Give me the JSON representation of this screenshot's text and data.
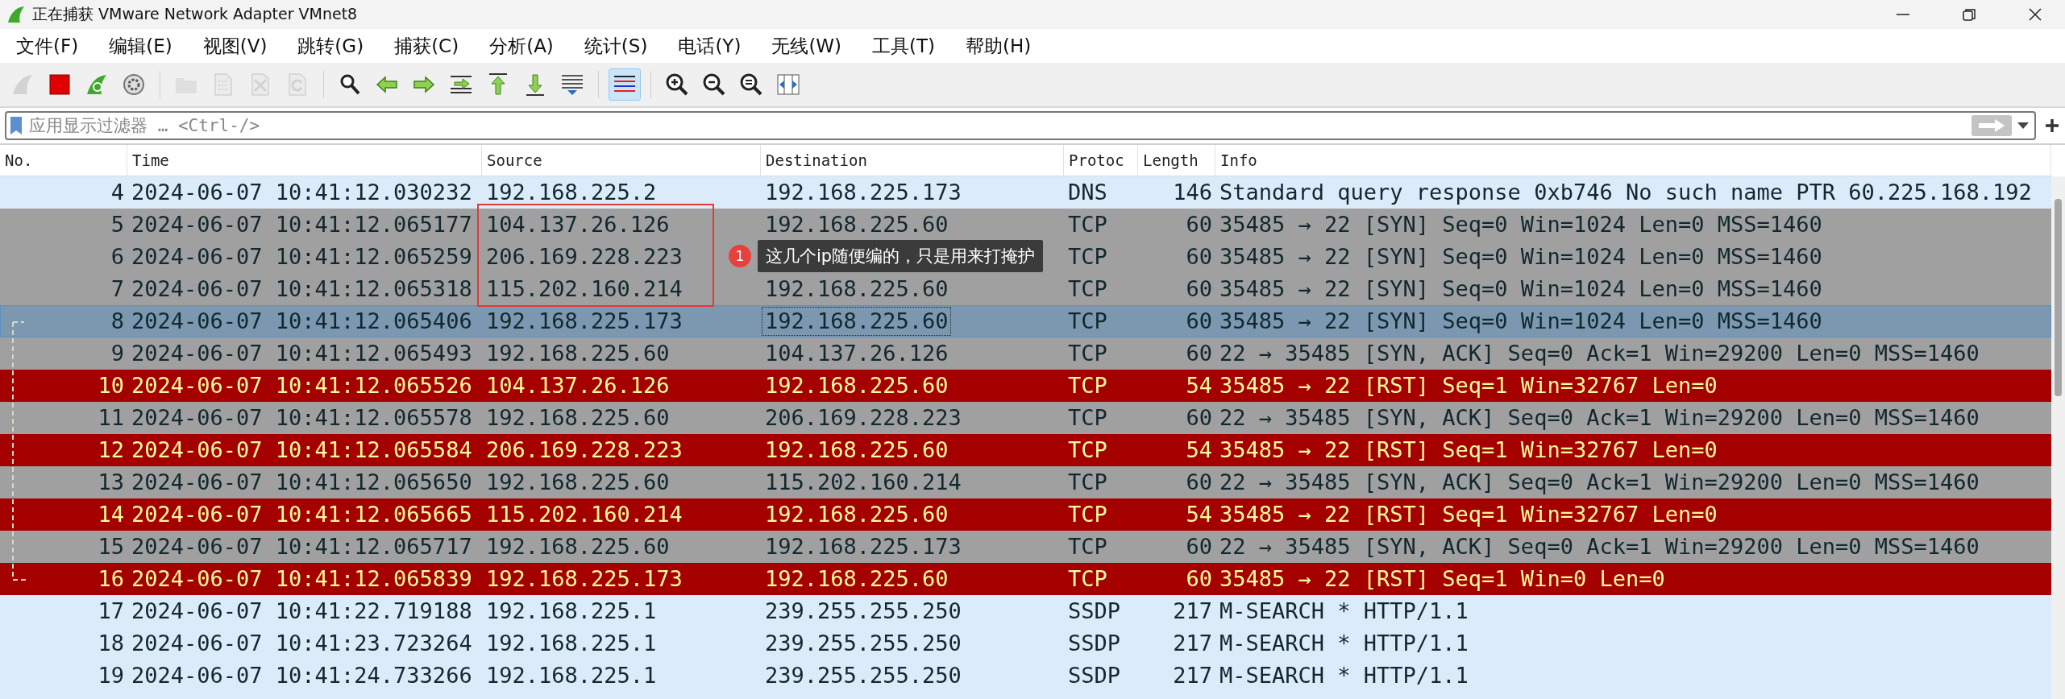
{
  "window": {
    "title": "正在捕获 VMware Network Adapter VMnet8"
  },
  "menu": [
    "文件(F)",
    "编辑(E)",
    "视图(V)",
    "跳转(G)",
    "捕获(C)",
    "分析(A)",
    "统计(S)",
    "电话(Y)",
    "无线(W)",
    "工具(T)",
    "帮助(H)"
  ],
  "toolbar": [
    {
      "kind": "fin",
      "disabled": true,
      "pressed": false
    },
    {
      "kind": "stop",
      "disabled": false,
      "pressed": false
    },
    {
      "kind": "restart",
      "disabled": false,
      "pressed": false
    },
    {
      "kind": "options",
      "disabled": false,
      "pressed": false
    },
    {
      "kind": "separator"
    },
    {
      "kind": "open",
      "disabled": true,
      "pressed": false
    },
    {
      "kind": "save",
      "disabled": true,
      "pressed": false
    },
    {
      "kind": "close",
      "disabled": true,
      "pressed": false
    },
    {
      "kind": "reload",
      "disabled": true,
      "pressed": false
    },
    {
      "kind": "separator"
    },
    {
      "kind": "find",
      "disabled": false,
      "pressed": false
    },
    {
      "kind": "back",
      "disabled": false,
      "pressed": false
    },
    {
      "kind": "forward",
      "disabled": false,
      "pressed": false
    },
    {
      "kind": "goto",
      "disabled": false,
      "pressed": false
    },
    {
      "kind": "first",
      "disabled": false,
      "pressed": false
    },
    {
      "kind": "last",
      "disabled": false,
      "pressed": false
    },
    {
      "kind": "autoscroll",
      "disabled": false,
      "pressed": false
    },
    {
      "kind": "separator"
    },
    {
      "kind": "colorize",
      "disabled": false,
      "pressed": true
    },
    {
      "kind": "separator"
    },
    {
      "kind": "zoomin",
      "disabled": false,
      "pressed": false
    },
    {
      "kind": "zoomout",
      "disabled": false,
      "pressed": false
    },
    {
      "kind": "zoomreset",
      "disabled": false,
      "pressed": false
    },
    {
      "kind": "resize",
      "disabled": false,
      "pressed": false
    }
  ],
  "filter": {
    "placeholder": "应用显示过滤器 … <Ctrl-/>",
    "apply_disabled": true
  },
  "table": {
    "columns": [
      "No.",
      "Time",
      "Source",
      "Destination",
      "Protoc",
      "Length",
      "Info"
    ],
    "rows": [
      {
        "no": "4",
        "time": "2024-06-07 10:41:12.030232",
        "source": "192.168.225.2",
        "destination": "192.168.225.173",
        "protocol": "DNS",
        "length": "146",
        "info": "Standard query response 0xb746 No such name PTR 60.225.168.192",
        "kind": "plain",
        "selected": false
      },
      {
        "no": "5",
        "time": "2024-06-07 10:41:12.065177",
        "source": "104.137.26.126",
        "destination": "192.168.225.60",
        "protocol": "TCP",
        "length": "60",
        "info": "35485 → 22 [SYN] Seq=0 Win=1024 Len=0 MSS=1460",
        "kind": "tcp",
        "selected": false
      },
      {
        "no": "6",
        "time": "2024-06-07 10:41:12.065259",
        "source": "206.169.228.223",
        "protocol": "TCP",
        "length": "60",
        "info": "35485 → 22 [SYN] Seq=0 Win=1024 Len=0 MSS=1460",
        "kind": "tcp",
        "selected": false
      },
      {
        "no": "7",
        "time": "2024-06-07 10:41:12.065318",
        "source": "115.202.160.214",
        "destination": "192.168.225.60",
        "protocol": "TCP",
        "length": "60",
        "info": "35485 → 22 [SYN] Seq=0 Win=1024 Len=0 MSS=1460",
        "kind": "tcp",
        "selected": false
      },
      {
        "no": "8",
        "time": "2024-06-07 10:41:12.065406",
        "source": "192.168.225.173",
        "destination": "192.168.225.60",
        "protocol": "TCP",
        "length": "60",
        "info": "35485 → 22 [SYN] Seq=0 Win=1024 Len=0 MSS=1460",
        "kind": "tcp",
        "selected": true
      },
      {
        "no": "9",
        "time": "2024-06-07 10:41:12.065493",
        "source": "192.168.225.60",
        "destination": "104.137.26.126",
        "protocol": "TCP",
        "length": "60",
        "info": "22 → 35485 [SYN, ACK] Seq=0 Ack=1 Win=29200 Len=0 MSS=1460",
        "kind": "tcp",
        "selected": false
      },
      {
        "no": "10",
        "time": "2024-06-07 10:41:12.065526",
        "source": "104.137.26.126",
        "destination": "192.168.225.60",
        "protocol": "TCP",
        "length": "54",
        "info": "35485 → 22 [RST] Seq=1 Win=32767 Len=0",
        "kind": "reset",
        "selected": false
      },
      {
        "no": "11",
        "time": "2024-06-07 10:41:12.065578",
        "source": "192.168.225.60",
        "destination": "206.169.228.223",
        "protocol": "TCP",
        "length": "60",
        "info": "22 → 35485 [SYN, ACK] Seq=0 Ack=1 Win=29200 Len=0 MSS=1460",
        "kind": "tcp",
        "selected": false
      },
      {
        "no": "12",
        "time": "2024-06-07 10:41:12.065584",
        "source": "206.169.228.223",
        "destination": "192.168.225.60",
        "protocol": "TCP",
        "length": "54",
        "info": "35485 → 22 [RST] Seq=1 Win=32767 Len=0",
        "kind": "reset",
        "selected": false
      },
      {
        "no": "13",
        "time": "2024-06-07 10:41:12.065650",
        "source": "192.168.225.60",
        "destination": "115.202.160.214",
        "protocol": "TCP",
        "length": "60",
        "info": "22 → 35485 [SYN, ACK] Seq=0 Ack=1 Win=29200 Len=0 MSS=1460",
        "kind": "tcp",
        "selected": false
      },
      {
        "no": "14",
        "time": "2024-06-07 10:41:12.065665",
        "source": "115.202.160.214",
        "destination": "192.168.225.60",
        "protocol": "TCP",
        "length": "54",
        "info": "35485 → 22 [RST] Seq=1 Win=32767 Len=0",
        "kind": "reset",
        "selected": false
      },
      {
        "no": "15",
        "time": "2024-06-07 10:41:12.065717",
        "source": "192.168.225.60",
        "destination": "192.168.225.173",
        "protocol": "TCP",
        "length": "60",
        "info": "22 → 35485 [SYN, ACK] Seq=0 Ack=1 Win=29200 Len=0 MSS=1460",
        "kind": "tcp",
        "selected": false
      },
      {
        "no": "16",
        "time": "2024-06-07 10:41:12.065839",
        "source": "192.168.225.173",
        "destination": "192.168.225.60",
        "protocol": "TCP",
        "length": "60",
        "info": "35485 → 22 [RST] Seq=1 Win=0 Len=0",
        "kind": "reset",
        "selected": false
      },
      {
        "no": "17",
        "time": "2024-06-07 10:41:22.719188",
        "source": "192.168.225.1",
        "destination": "239.255.255.250",
        "protocol": "SSDP",
        "length": "217",
        "info": "M-SEARCH * HTTP/1.1",
        "kind": "plain",
        "selected": false
      },
      {
        "no": "18",
        "time": "2024-06-07 10:41:23.723264",
        "source": "192.168.225.1",
        "destination": "239.255.255.250",
        "protocol": "SSDP",
        "length": "217",
        "info": "M-SEARCH * HTTP/1.1",
        "kind": "plain",
        "selected": false
      },
      {
        "no": "19",
        "time": "2024-06-07 10:41:24.733266",
        "source": "192.168.225.1",
        "destination": "239.255.255.250",
        "protocol": "SSDP",
        "length": "217",
        "info": "M-SEARCH * HTTP/1.1",
        "kind": "plain",
        "selected": false
      }
    ]
  },
  "annotation": {
    "badge": "1",
    "note": "这几个ip随便编的，只是用来打掩护"
  }
}
